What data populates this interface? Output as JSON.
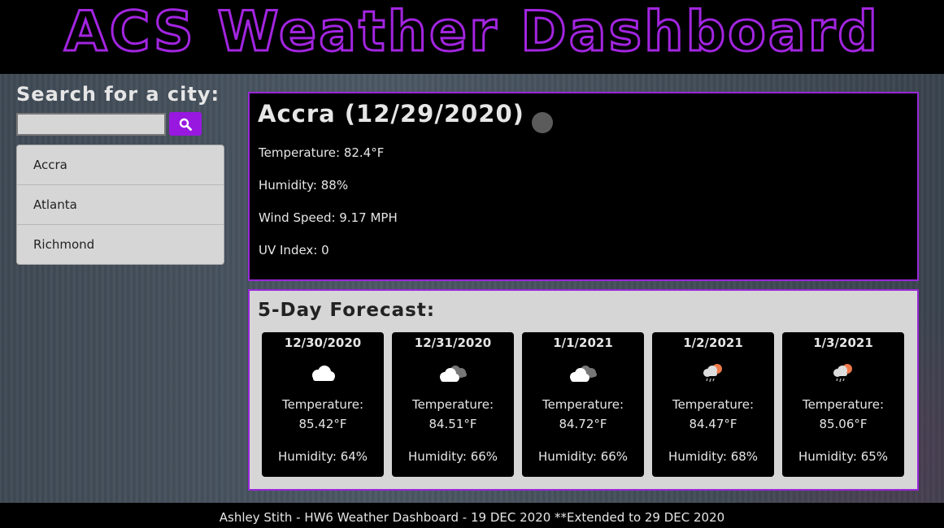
{
  "header": {
    "title": "ACS Weather Dashboard"
  },
  "search": {
    "label": "Search for a city:",
    "input_value": "",
    "button_icon": "search-icon"
  },
  "history": [
    {
      "city": "Accra"
    },
    {
      "city": "Atlanta"
    },
    {
      "city": "Richmond"
    }
  ],
  "current": {
    "title": "Accra (12/29/2020)",
    "temperature": "Temperature: 82.4°F",
    "humidity": "Humidity: 88%",
    "wind": "Wind Speed: 9.17 MPH",
    "uv": "UV Index: 0"
  },
  "forecast": {
    "title": "5-Day Forecast:",
    "days": [
      {
        "date": "12/30/2020",
        "icon": "cloud-icon",
        "temp_label": "Temperature:",
        "temp": "85.42°F",
        "humidity": "Humidity: 64%"
      },
      {
        "date": "12/31/2020",
        "icon": "broken-clouds-icon",
        "temp_label": "Temperature:",
        "temp": "84.51°F",
        "humidity": "Humidity: 66%"
      },
      {
        "date": "1/1/2021",
        "icon": "broken-clouds-icon",
        "temp_label": "Temperature:",
        "temp": "84.72°F",
        "humidity": "Humidity: 66%"
      },
      {
        "date": "1/2/2021",
        "icon": "sun-rain-icon",
        "temp_label": "Temperature:",
        "temp": "84.47°F",
        "humidity": "Humidity: 68%"
      },
      {
        "date": "1/3/2021",
        "icon": "sun-rain-icon",
        "temp_label": "Temperature:",
        "temp": "85.06°F",
        "humidity": "Humidity: 65%"
      }
    ]
  },
  "footer": {
    "text": "Ashley Stith - HW6 Weather Dashboard - 19 DEC 2020 **Extended to 29 DEC 2020"
  },
  "colors": {
    "accent": "#9a27d9",
    "button": "#9818e0",
    "panel_dark": "#000000",
    "panel_light": "#d6d6d6"
  }
}
